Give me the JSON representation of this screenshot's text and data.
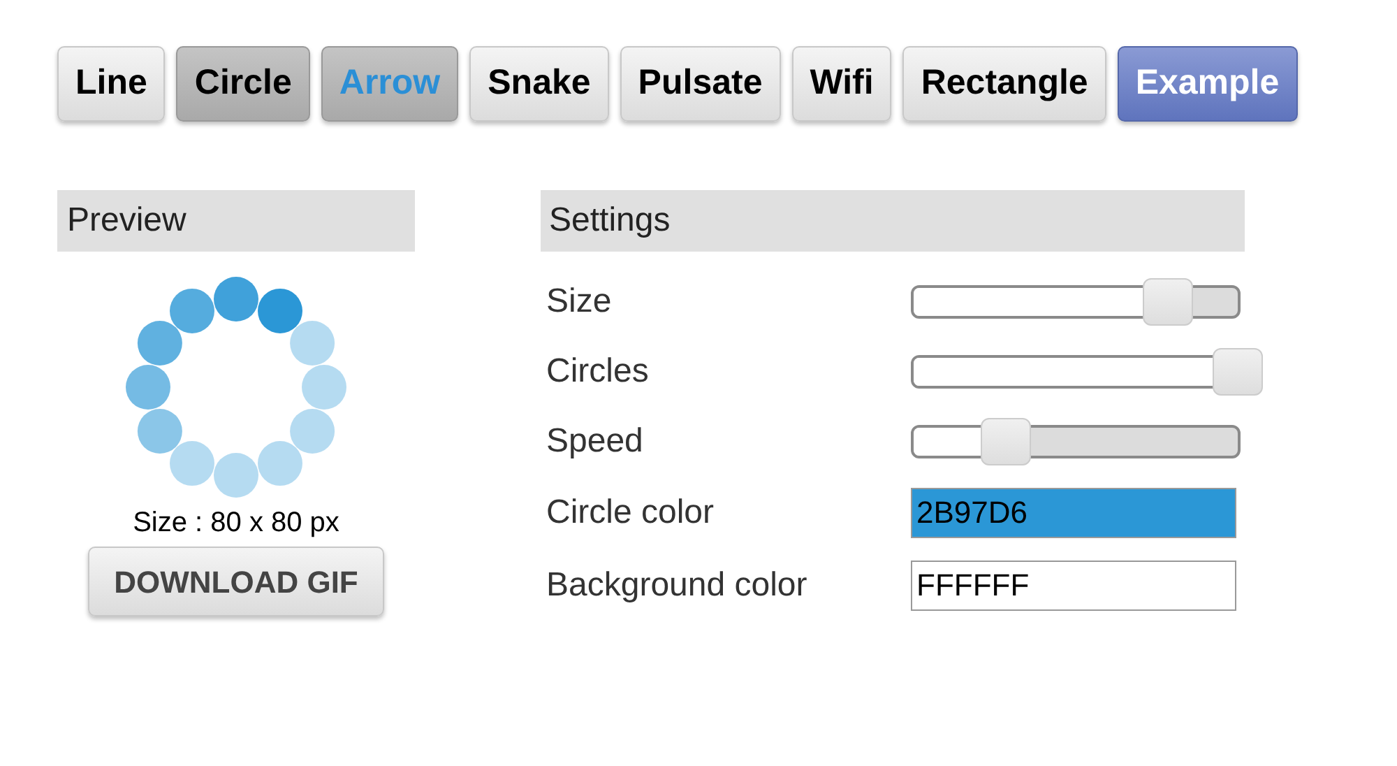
{
  "tabs": [
    {
      "label": "Line",
      "kind": "plain"
    },
    {
      "label": "Circle",
      "kind": "pressed"
    },
    {
      "label": "Arrow",
      "kind": "hover"
    },
    {
      "label": "Snake",
      "kind": "plain"
    },
    {
      "label": "Pulsate",
      "kind": "plain"
    },
    {
      "label": "Wifi",
      "kind": "plain"
    },
    {
      "label": "Rectangle",
      "kind": "plain"
    },
    {
      "label": "Example",
      "kind": "primary"
    }
  ],
  "preview": {
    "title": "Preview",
    "size_text": "Size : 80 x 80 px",
    "download_button": "DOWNLOAD GIF"
  },
  "settings": {
    "title": "Settings",
    "rows": [
      {
        "kind": "slider",
        "label": "Size",
        "level": 0.77
      },
      {
        "kind": "slider",
        "label": "Circles",
        "level": 1
      },
      {
        "kind": "slider",
        "label": "Speed",
        "level": 0.23
      },
      {
        "kind": "color",
        "label": "Circle color",
        "value": "2B97D6",
        "color": "#2b97d6"
      },
      {
        "kind": "color",
        "label": "Background color",
        "value": "FFFFFF",
        "color": "#ffffff"
      }
    ]
  }
}
